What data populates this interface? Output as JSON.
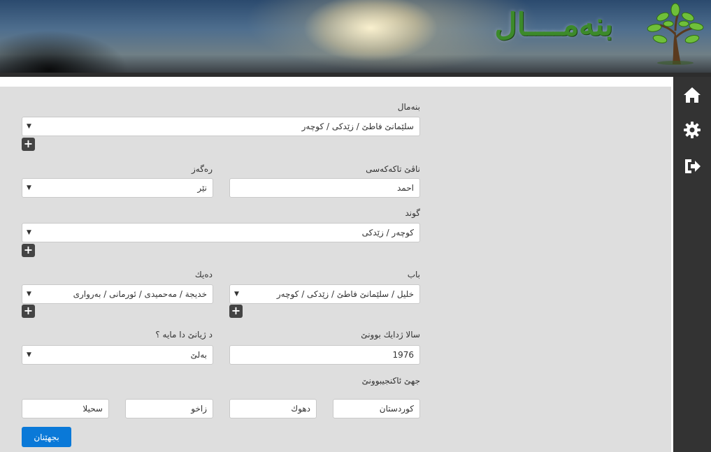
{
  "header": {
    "logo_text": "بنەمــــال"
  },
  "sidebar": {
    "items": [
      {
        "icon": "home-icon"
      },
      {
        "icon": "gear-icon"
      },
      {
        "icon": "sign-out-icon"
      }
    ]
  },
  "form": {
    "family": {
      "label": "بنەمال",
      "value": "سلێمانێ فاطێ / زێدکی / کوچەر"
    },
    "personal_name": {
      "label": "ناڤێ تاکەکەسی",
      "value": "احمد"
    },
    "gender": {
      "label": "رەگەز",
      "value": "نێر"
    },
    "village": {
      "label": "گوند",
      "value": "کوچەر / زێدکی"
    },
    "father": {
      "label": "باب",
      "value": "خلیل / سلێمانێ فاطێ / زێدکی / کوچەر"
    },
    "mother": {
      "label": "دەیك",
      "value": "خدیجة / مەحمیدی / ئورمانی / بەرواری"
    },
    "birth_year": {
      "label": "سالا ژدایك بوونێ",
      "value": "1976"
    },
    "alive": {
      "label": "د ژیانێ دا مایە ؟",
      "value": "بەلێ"
    },
    "birthplace": {
      "label": "جهێ ئاکنجیبوونێ",
      "fields": [
        "کوردستان",
        "دهوك",
        "زاخو",
        "سحیلا"
      ]
    },
    "submit_label": "بجهێنان"
  },
  "colors": {
    "sidebar_bg": "#333333",
    "content_bg": "#dedede",
    "submit_bg": "#0a79d8",
    "logo_green": "#3c8a2a"
  }
}
